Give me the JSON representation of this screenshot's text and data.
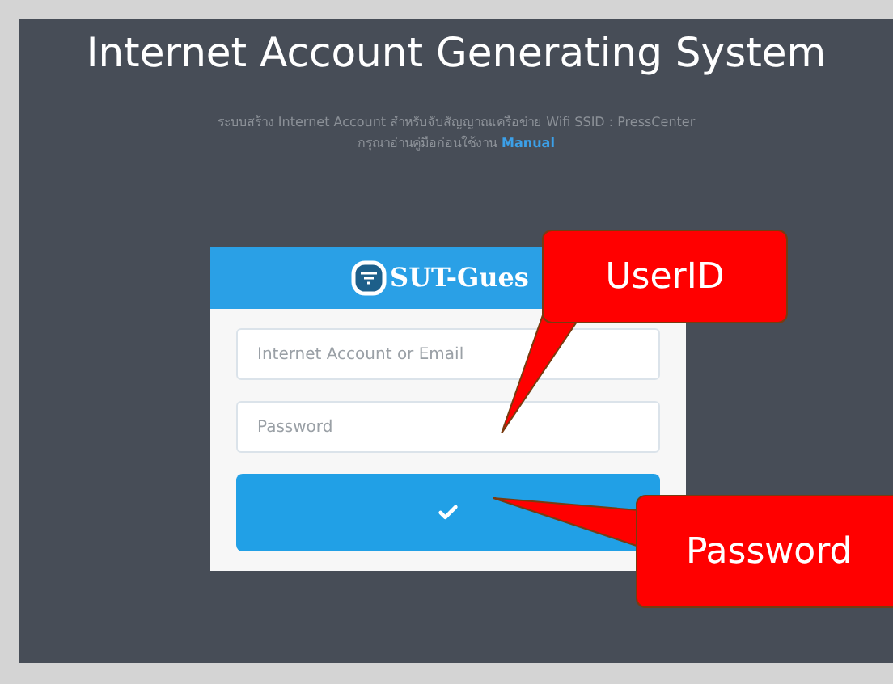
{
  "title": "Internet Account Generating System",
  "description": {
    "line_1": "ระบบสร้าง Internet Account สำหรับจับสัญญาณเครือข่าย Wifi SSID : PressCenter",
    "line_2": "กรุณาอ่านคู่มือก่อนใช้งาน",
    "link": "Manual"
  },
  "login_card": {
    "brand": "SUT-Gues",
    "username": {
      "placeholder": "Internet Account or Email"
    },
    "password": {
      "placeholder": "Password"
    }
  },
  "callouts": [
    {
      "text": "UserID"
    },
    {
      "text": "Password"
    }
  ]
}
